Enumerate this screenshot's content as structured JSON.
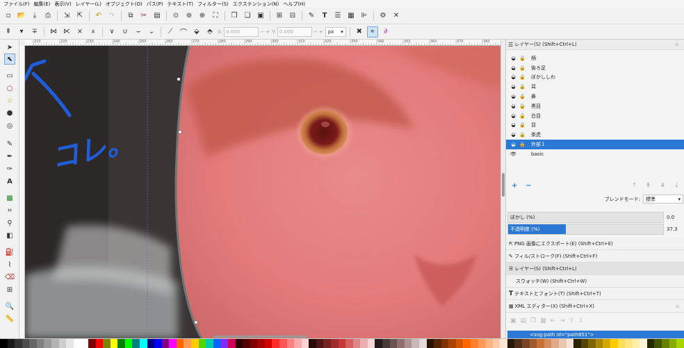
{
  "menu": [
    "ファイル(F)",
    "編集(E)",
    "表示(V)",
    "レイヤー(L)",
    "オブジェクト(O)",
    "パス(P)",
    "テキスト(T)",
    "フィルター(S)",
    "エクステンション(N)",
    "ヘルプ(H)"
  ],
  "coords": {
    "x_label": "X:",
    "x_value": "0.000",
    "y_label": "Y:",
    "y_value": "0.000",
    "unit": "px"
  },
  "ruler_labels": [
    "210",
    "220",
    "230",
    "240",
    "250",
    "260",
    "270",
    "280",
    "290",
    "300",
    "310",
    "320",
    "330",
    "340",
    "350",
    "360",
    "370",
    "380"
  ],
  "annotation": {
    "text": "コレ。"
  },
  "layers_panel": {
    "title": "レイヤー(S) (Shift+Ctrl+L)",
    "layers": [
      {
        "name": "柄",
        "selected": false
      },
      {
        "name": "後ろ足",
        "selected": false
      },
      {
        "name": "ぼかししわ",
        "selected": false
      },
      {
        "name": "耳",
        "selected": false
      },
      {
        "name": "鼻",
        "selected": false
      },
      {
        "name": "黒目",
        "selected": false
      },
      {
        "name": "白目",
        "selected": false
      },
      {
        "name": "目",
        "selected": false
      },
      {
        "name": "茶虎",
        "selected": false
      },
      {
        "name": "外部１",
        "selected": true
      },
      {
        "name": "basic",
        "selected": false
      }
    ],
    "add_label": "+",
    "remove_label": "−",
    "blend_label": "ブレンドモード:",
    "blend_value": "標準",
    "blur_label": "ぼかし (%)",
    "blur_value": "0.0",
    "opacity_label": "不透明度 (%)",
    "opacity_value": "37.3"
  },
  "docks": [
    {
      "label": "PNG 画像にエクスポート(E) (Shift+Ctrl+E)",
      "icon": "export-icon"
    },
    {
      "label": "フィル/ストローク(F) (Shift+Ctrl+F)",
      "icon": "fill-stroke-icon"
    },
    {
      "label": "レイヤー(S) (Shift+Ctrl+L)",
      "icon": "layers-icon"
    },
    {
      "label": "スウォッチ(W) (Shift+Ctrl+W)",
      "icon": ""
    },
    {
      "label": "テキストとフォント(T) (Shift+Ctrl+T)",
      "icon": "text-font-icon"
    },
    {
      "label": "XML エディター(X) (Shift+Ctrl+X)",
      "icon": "xml-icon"
    }
  ],
  "xml_node": "<svg:path id=\"path851\">",
  "colors": {
    "accent": "#2b79d4",
    "annotation": "#1f5ed8"
  },
  "palette": [
    "#000000",
    "#1a1a1a",
    "#333333",
    "#4d4d4d",
    "#666666",
    "#808080",
    "#999999",
    "#b3b3b3",
    "#cccccc",
    "#e6e6e6",
    "#ffffff",
    "#ffffff",
    "#800000",
    "#ff0000",
    "#808000",
    "#ffff00",
    "#008000",
    "#00ff00",
    "#008080",
    "#00ffff",
    "#000080",
    "#0000ff",
    "#800080",
    "#ff00ff",
    "#ff6600",
    "#ff9955",
    "#ffcc00",
    "#55d400",
    "#00ccaa",
    "#0066ff",
    "#7f2aff",
    "#d40055",
    "#2b0000",
    "#550000",
    "#800000",
    "#aa0000",
    "#d40000",
    "#ff2a2a",
    "#ff5555",
    "#ff8080",
    "#ffaaaa",
    "#ffd5d5",
    "#280b0b",
    "#501616",
    "#782121",
    "#a02c2c",
    "#c83737",
    "#d35f5f",
    "#de8787",
    "#e9afaf",
    "#f4d7d7",
    "#241c1c",
    "#483737",
    "#6c5353",
    "#916f6f",
    "#ac9393",
    "#c8b7b7",
    "#e3dbdb",
    "#2b1100",
    "#552200",
    "#803300",
    "#aa4400",
    "#d45500",
    "#ff6600",
    "#ff7f2a",
    "#ff9955",
    "#ffb380",
    "#ffccaa",
    "#ffe6d5",
    "#28170b",
    "#502d16",
    "#784421",
    "#a05a2c",
    "#c87137",
    "#d38d5f",
    "#deaa87",
    "#e9c6af",
    "#f4e3d7",
    "#2b2200",
    "#554400",
    "#806600",
    "#aa8800",
    "#d4aa00",
    "#ffcc00",
    "#ffdd55",
    "#ffe680",
    "#ffeeaa",
    "#fff6d5",
    "#222b00",
    "#445500",
    "#668000",
    "#88aa00",
    "#aad400"
  ]
}
